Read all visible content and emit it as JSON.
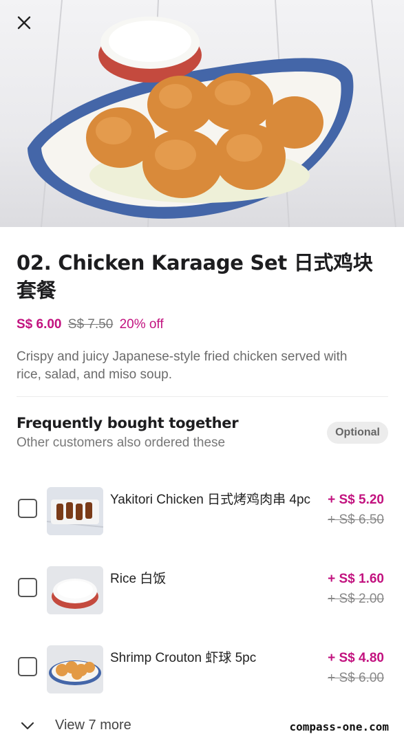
{
  "product": {
    "title": "02. Chicken Karaage Set 日式鸡块套餐",
    "price_now": "S$ 6.00",
    "price_old": "S$ 7.50",
    "discount": "20% off",
    "description": "Crispy and juicy Japanese-style fried chicken served with rice, salad, and miso soup."
  },
  "fbt": {
    "title": "Frequently bought together",
    "subtitle": "Other customers also ordered these",
    "badge": "Optional",
    "items": [
      {
        "name": "Yakitori Chicken 日式烤鸡肉串 4pc",
        "price_new": "+ S$ 5.20",
        "price_old": "+ S$ 6.50",
        "thumb": "yakitori-thumbnail"
      },
      {
        "name": "Rice 白饭",
        "price_new": "+ S$ 1.60",
        "price_old": "+ S$ 2.00",
        "thumb": "rice-thumbnail"
      },
      {
        "name": "Shrimp Crouton 虾球 5pc",
        "price_new": "+ S$ 4.80",
        "price_old": "+ S$ 6.00",
        "thumb": "shrimp-thumbnail"
      }
    ],
    "view_more": "View 7 more"
  },
  "watermark": "compass-one.com",
  "colors": {
    "accent": "#c2127f",
    "text": "#1d1d1f",
    "muted": "#777777"
  },
  "icons": {
    "close": "close-icon",
    "expand": "chevron-down-icon"
  }
}
